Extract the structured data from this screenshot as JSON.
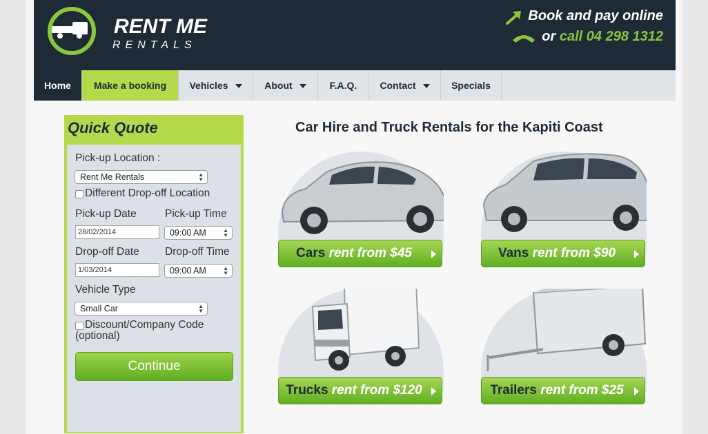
{
  "brand": {
    "name": "RENT ME",
    "tagline": "RENTALS"
  },
  "header_cta": {
    "line1": "Book and pay online",
    "line2_prefix": "or",
    "phone": "call 04 298 1312"
  },
  "nav": {
    "items": [
      {
        "label": "Home",
        "dropdown": false
      },
      {
        "label": "Make a booking",
        "dropdown": false
      },
      {
        "label": "Vehicles",
        "dropdown": true
      },
      {
        "label": "About",
        "dropdown": true
      },
      {
        "label": "F.A.Q.",
        "dropdown": false
      },
      {
        "label": "Contact",
        "dropdown": true
      },
      {
        "label": "Specials",
        "dropdown": false
      }
    ]
  },
  "quick_quote": {
    "title": "Quick Quote",
    "pickup_location_label": "Pick-up Location :",
    "pickup_location_value": "Rent Me Rentals",
    "different_dropoff_label": "Different Drop-off Location",
    "pickup_date_label": "Pick-up Date",
    "pickup_time_label": "Pick-up Time",
    "pickup_date_value": "28/02/2014",
    "pickup_time_value": "09:00 AM",
    "dropoff_date_label": "Drop-off Date",
    "dropoff_time_label": "Drop-off Time",
    "dropoff_date_value": "1/03/2014",
    "dropoff_time_value": "09:00 AM",
    "vehicle_type_label": "Vehicle Type",
    "vehicle_type_value": "Small Car",
    "discount_label_1": "Discount/Company Code",
    "discount_label_2": "(optional)",
    "continue_label": "Continue"
  },
  "main": {
    "title": "Car Hire and Truck Rentals for the Kapiti Coast",
    "tiles": [
      {
        "kind": "Cars",
        "price": "rent from $45"
      },
      {
        "kind": "Vans",
        "price": "rent from $90"
      },
      {
        "kind": "Trucks",
        "price": "rent from $120"
      },
      {
        "kind": "Trailers",
        "price": "rent from $25"
      }
    ]
  },
  "colors": {
    "header_bg": "#1e2a36",
    "accent_green": "#8cc63f",
    "nav_bg": "#dfe4e8"
  }
}
